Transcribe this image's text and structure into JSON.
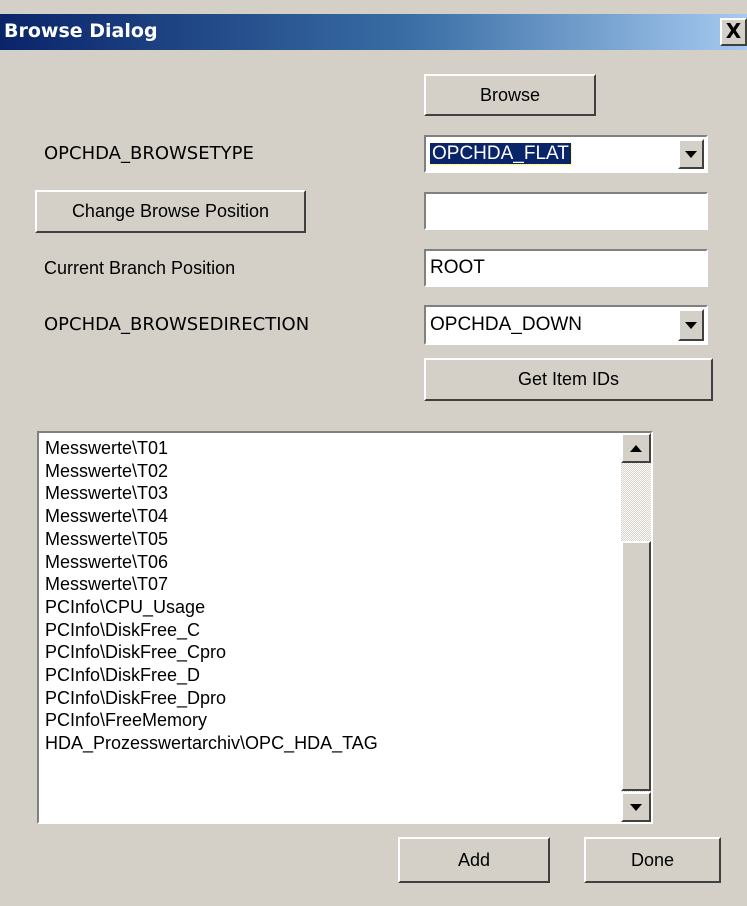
{
  "window": {
    "title": "Browse Dialog",
    "close_glyph": "X"
  },
  "browse_button": "Browse",
  "browsetype": {
    "label": "OPCHDA_BROWSETYPE",
    "value": "OPCHDA_FLAT"
  },
  "change_position_button": "Change Browse Position",
  "position_input": {
    "value": ""
  },
  "branch": {
    "label": "Current Branch Position",
    "value": "ROOT"
  },
  "browsedirection": {
    "label": "OPCHDA_BROWSEDIRECTION",
    "value": "OPCHDA_DOWN"
  },
  "get_item_ids_button": "Get Item IDs",
  "items": [
    "Messwerte\\T01",
    "Messwerte\\T02",
    "Messwerte\\T03",
    "Messwerte\\T04",
    "Messwerte\\T05",
    "Messwerte\\T06",
    "Messwerte\\T07",
    "PCInfo\\CPU_Usage",
    "PCInfo\\DiskFree_C",
    "PCInfo\\DiskFree_Cpro",
    "PCInfo\\DiskFree_D",
    "PCInfo\\DiskFree_Dpro",
    "PCInfo\\FreeMemory",
    "HDA_Prozesswertarchiv\\OPC_HDA_TAG"
  ],
  "add_button": "Add",
  "done_button": "Done",
  "colors": {
    "titlebar_start": "#0a246a",
    "titlebar_end": "#a6caf0",
    "face": "#d4d0c8"
  },
  "icons": {
    "close": "close-icon",
    "dropdown": "chevron-down-icon",
    "scroll_up": "scroll-up-icon",
    "scroll_down": "scroll-down-icon"
  }
}
